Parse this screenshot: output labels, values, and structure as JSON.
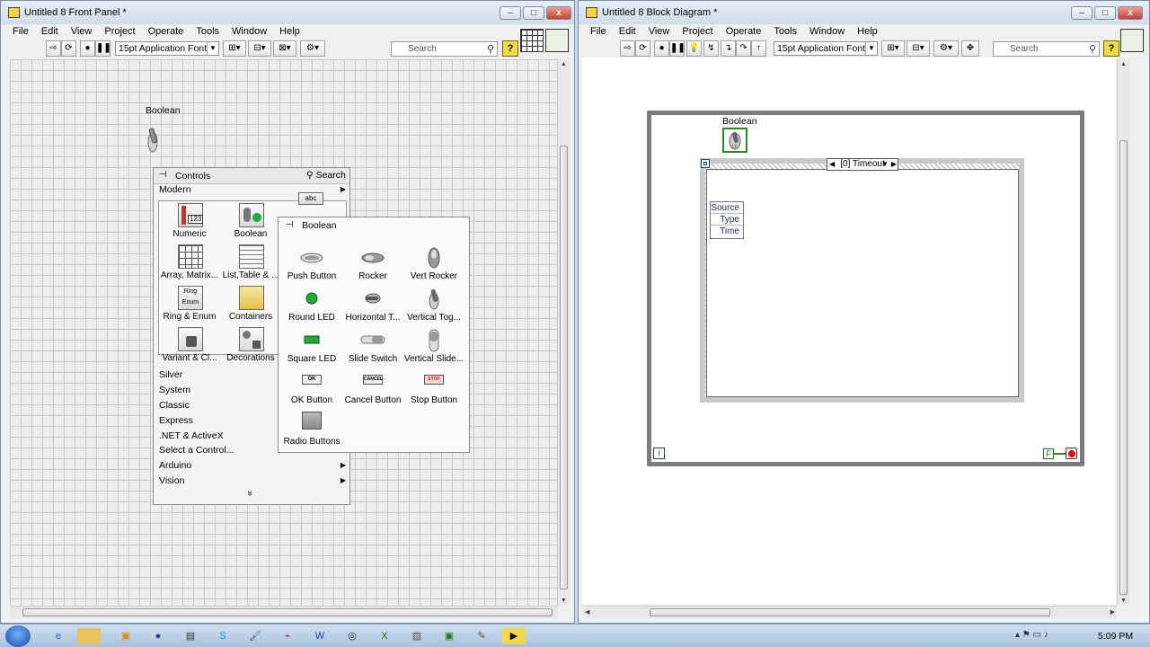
{
  "front_panel": {
    "title": "Untitled 8 Front Panel *",
    "menu": [
      "File",
      "Edit",
      "View",
      "Project",
      "Operate",
      "Tools",
      "Window",
      "Help"
    ],
    "font_label": "15pt Application Font",
    "search_placeholder": "Search",
    "help_label": "?",
    "control_label": "Boolean"
  },
  "palette": {
    "title": "Controls",
    "search_label": "Search",
    "modern_label": "Modern",
    "grid": [
      "Numeric",
      "Boolean",
      "Array, Matrix...",
      "List,Table & ...",
      "Ring & Enum",
      "Containers",
      "Variant & Cl...",
      "Decorations"
    ],
    "categories": [
      "Silver",
      "System",
      "Classic",
      "Express",
      ".NET & ActiveX",
      "Select a Control...",
      "Arduino",
      "Vision"
    ],
    "more_label": "»",
    "grid_icon_text": {
      "numeric": "123",
      "string": "abc",
      "ring": "Ring",
      "enum": "Enum"
    }
  },
  "boolean_palette": {
    "title": "Boolean",
    "items": [
      "Push Button",
      "Rocker",
      "Vert Rocker",
      "Round LED",
      "Horizontal T...",
      "Vertical Tog...",
      "Square LED",
      "Slide Switch",
      "Vertical Slide...",
      "OK Button",
      "Cancel Button",
      "Stop Button",
      "Radio Buttons"
    ],
    "button_glyphs": {
      "ok": "OK",
      "cancel": "CANCEL",
      "stop": "STOP"
    }
  },
  "block_diagram": {
    "title": "Untitled 8 Block Diagram *",
    "menu": [
      "File",
      "Edit",
      "View",
      "Project",
      "Operate",
      "Tools",
      "Window",
      "Help"
    ],
    "font_label": "15pt Application Font",
    "search_placeholder": "Search",
    "help_label": "?",
    "terminal_label": "Boolean",
    "terminal_type": "TF",
    "event_selector": "[0] Timeout",
    "event_data": [
      "Source",
      "Type",
      "Time"
    ],
    "iteration_label": "i",
    "false_constant": "F"
  },
  "taskbar": {
    "clock": "5:09 PM"
  }
}
